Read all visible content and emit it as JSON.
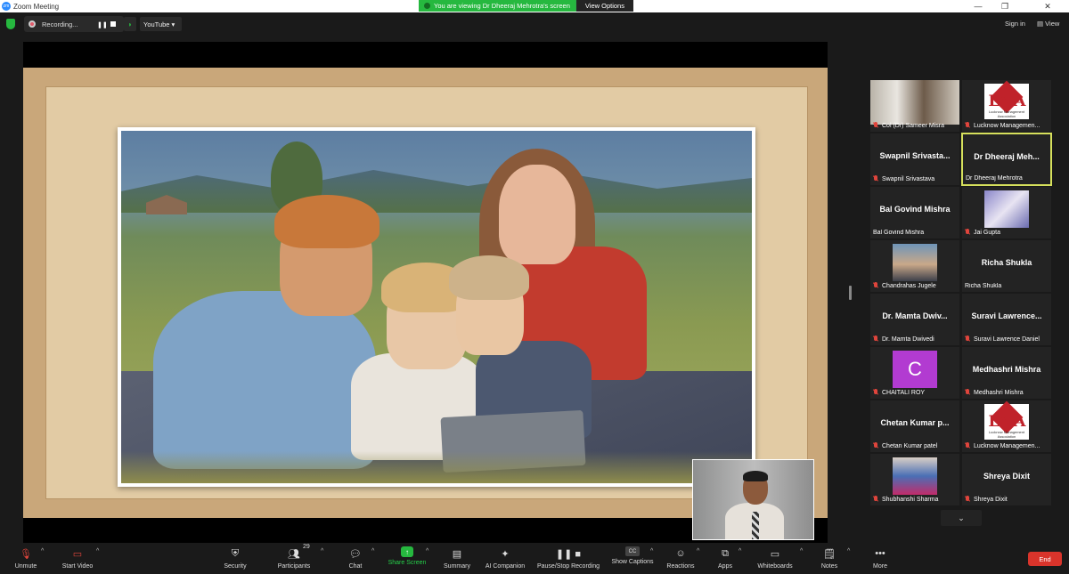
{
  "window": {
    "title": "Zoom Meeting",
    "app_logo": "zm"
  },
  "share_banner": {
    "message": "You are viewing Dr Dheeraj Mehrotra's screen",
    "view_options": "View Options"
  },
  "topbar": {
    "recording_label": "Recording...",
    "youtube_label": "YouTube ▾",
    "sign_in": "Sign in",
    "view": "View"
  },
  "gallery": {
    "tiles": [
      {
        "name": "Col (Dr) Sameer Misra",
        "display": "",
        "type": "photo"
      },
      {
        "name": "Lucknow Managemen...",
        "display": "",
        "type": "lma"
      },
      {
        "name": "Swapnil Srivastava",
        "display": "Swapnil Srivasta...",
        "type": "text"
      },
      {
        "name": "Dr Dheeraj Mehrotra",
        "display": "Dr Dheeraj Meh...",
        "type": "text",
        "active": true
      },
      {
        "name": "Bal Govind Mishra",
        "display": "Bal Govind Mishra",
        "type": "text"
      },
      {
        "name": "Jai Gupta",
        "display": "",
        "type": "photo"
      },
      {
        "name": "Chandrahas Jugele",
        "display": "",
        "type": "photo"
      },
      {
        "name": "Richa Shukla",
        "display": "Richa Shukla",
        "type": "text"
      },
      {
        "name": "Dr. Mamta Dwivedi",
        "display": "Dr. Mamta Dwiv...",
        "type": "text"
      },
      {
        "name": "Suravi Lawrence Daniel",
        "display": "Suravi Lawrence...",
        "type": "text"
      },
      {
        "name": "CHAITALI ROY",
        "display": "C",
        "type": "avatar"
      },
      {
        "name": "Medhashri Mishra",
        "display": "Medhashri Mishra",
        "type": "text"
      },
      {
        "name": "Chetan Kumar patel",
        "display": "Chetan Kumar p...",
        "type": "text"
      },
      {
        "name": "Lucknow Managemen...",
        "display": "",
        "type": "lma"
      },
      {
        "name": "Shubhanshi Sharma",
        "display": "",
        "type": "photo"
      },
      {
        "name": "Shreya Dixit",
        "display": "Shreya Dixit",
        "type": "text"
      }
    ],
    "lma_text": "LMA",
    "lma_sub": "Lucknow Management Association",
    "scroll_icon": "chevron-down-icon"
  },
  "toolbar": {
    "unmute": "Unmute",
    "start_video": "Start Video",
    "security": "Security",
    "participants": "Participants",
    "participants_count": "29",
    "chat": "Chat",
    "share_screen": "Share Screen",
    "summary": "Summary",
    "ai_companion": "AI Companion",
    "pause_stop_recording": "Pause/Stop Recording",
    "show_captions": "Show Captions",
    "captions_badge": "CC",
    "reactions": "Reactions",
    "apps": "Apps",
    "whiteboards": "Whiteboards",
    "notes": "Notes",
    "more": "More",
    "end": "End"
  },
  "colors": {
    "accent_green": "#26b83f",
    "end_red": "#d9342b",
    "active_speaker": "#d6e05c",
    "muted_red": "#e0453c"
  }
}
